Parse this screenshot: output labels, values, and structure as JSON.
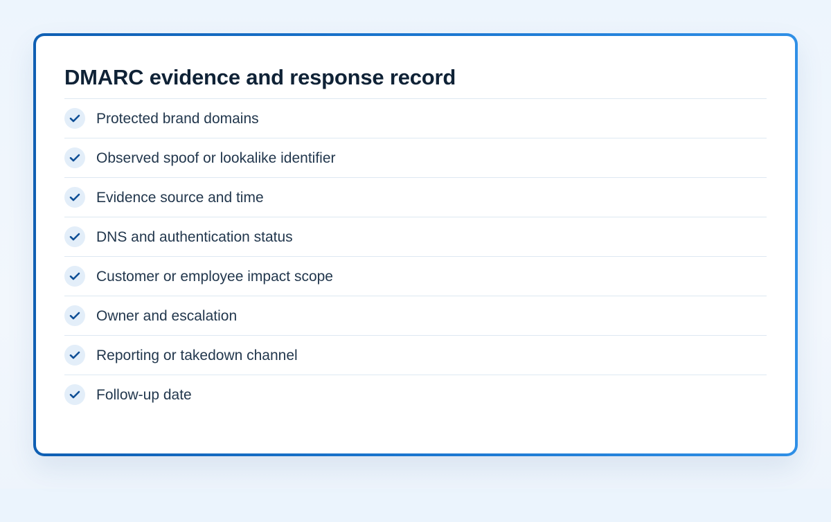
{
  "card": {
    "title": "DMARC evidence and response record",
    "items": [
      {
        "label": "Protected brand domains",
        "icon": "check-icon",
        "checked": true
      },
      {
        "label": "Observed spoof or lookalike identifier",
        "icon": "check-icon",
        "checked": true
      },
      {
        "label": "Evidence source and time",
        "icon": "check-icon",
        "checked": true
      },
      {
        "label": "DNS and authentication status",
        "icon": "check-icon",
        "checked": true
      },
      {
        "label": "Customer or employee impact scope",
        "icon": "check-icon",
        "checked": true
      },
      {
        "label": "Owner and escalation",
        "icon": "check-icon",
        "checked": true
      },
      {
        "label": "Reporting or takedown channel",
        "icon": "check-icon",
        "checked": true
      },
      {
        "label": "Follow-up date",
        "icon": "check-icon",
        "checked": true
      }
    ]
  },
  "colors": {
    "accent": "#1a6fc6",
    "check": "#0f4f96",
    "badge": "#e3eef9",
    "title": "#0f2236",
    "text": "#22374d",
    "divider": "#dde8f2"
  }
}
